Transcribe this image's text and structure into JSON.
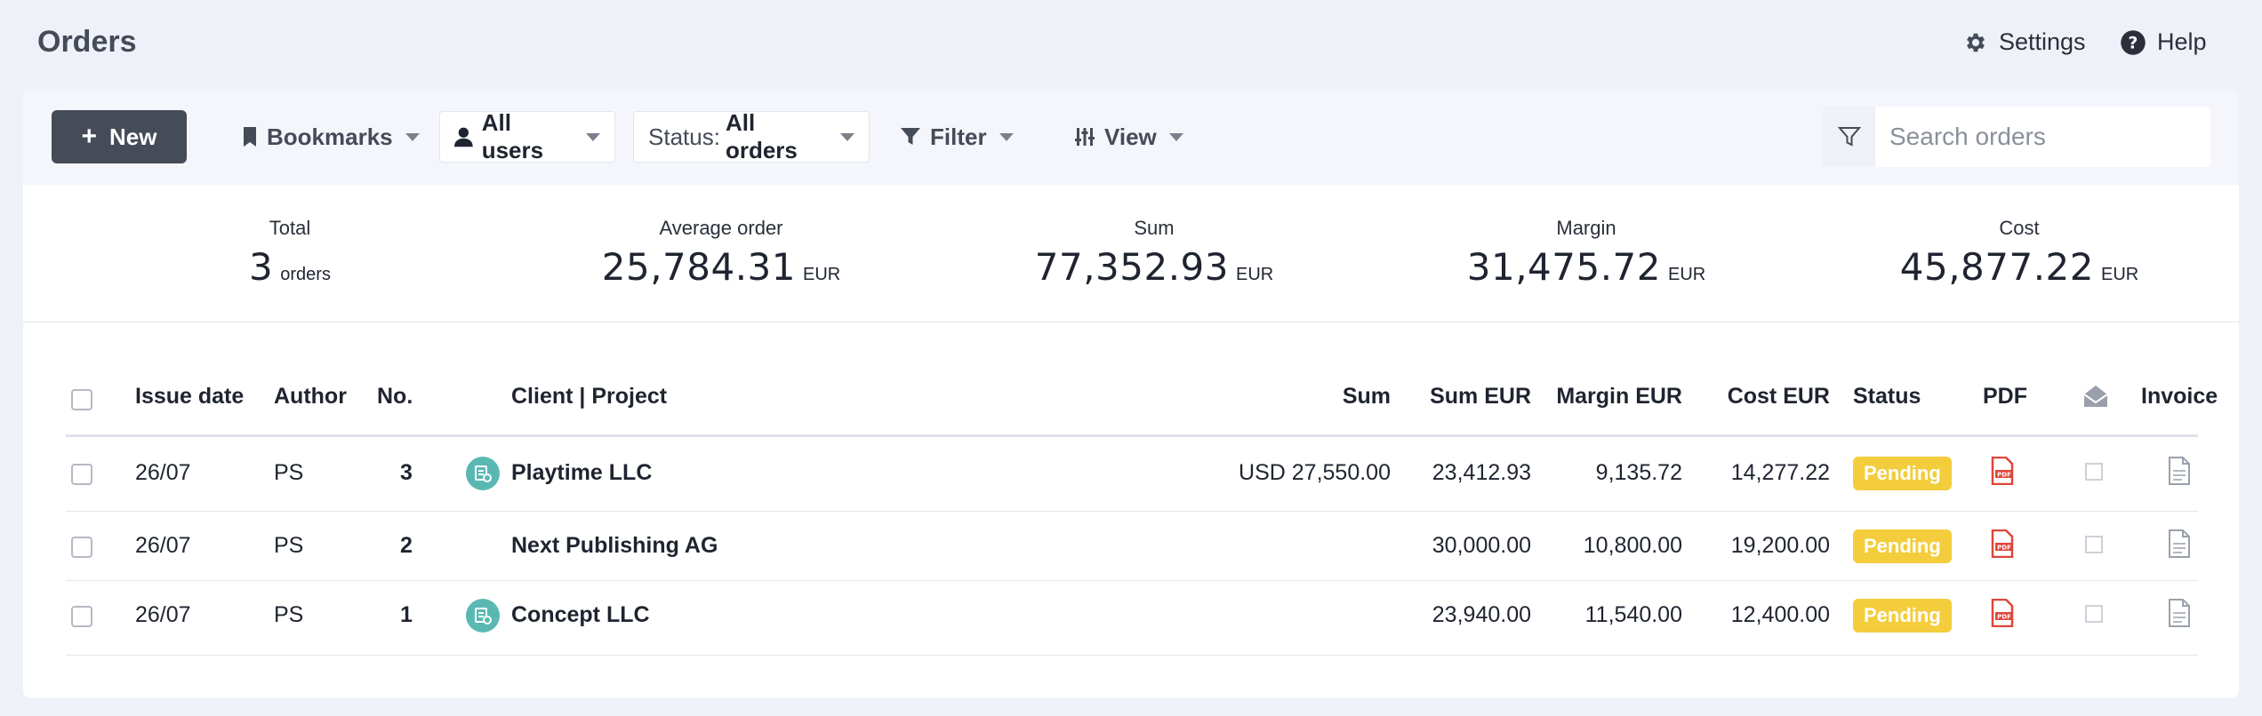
{
  "header": {
    "title": "Orders",
    "settings_label": "Settings",
    "help_label": "Help"
  },
  "toolbar": {
    "new_label": "New",
    "bookmarks_label": "Bookmarks",
    "users_label": "All users",
    "status_prefix": "Status:",
    "status_value": "All orders",
    "filter_label": "Filter",
    "view_label": "View",
    "search_placeholder": "Search orders"
  },
  "stats": [
    {
      "label": "Total",
      "value": "3",
      "unit": "orders"
    },
    {
      "label": "Average order",
      "value": "25,784.31",
      "unit": "EUR"
    },
    {
      "label": "Sum",
      "value": "77,352.93",
      "unit": "EUR"
    },
    {
      "label": "Margin",
      "value": "31,475.72",
      "unit": "EUR"
    },
    {
      "label": "Cost",
      "value": "45,877.22",
      "unit": "EUR"
    }
  ],
  "table": {
    "columns": {
      "issue_date": "Issue date",
      "author": "Author",
      "no": "No.",
      "client_project": "Client | Project",
      "sum": "Sum",
      "sum_eur": "Sum EUR",
      "margin_eur": "Margin EUR",
      "cost_eur": "Cost EUR",
      "status": "Status",
      "pdf": "PDF",
      "invoice": "Invoice"
    },
    "rows": [
      {
        "date": "26/07",
        "author": "PS",
        "no": "3",
        "client": "Playtime LLC",
        "has_project_icon": true,
        "sum": "USD 27,550.00",
        "sum_eur": "23,412.93",
        "margin_eur": "9,135.72",
        "cost_eur": "14,277.22",
        "status": "Pending"
      },
      {
        "date": "26/07",
        "author": "PS",
        "no": "2",
        "client": "Next Publishing AG",
        "has_project_icon": false,
        "sum": "",
        "sum_eur": "30,000.00",
        "margin_eur": "10,800.00",
        "cost_eur": "19,200.00",
        "status": "Pending"
      },
      {
        "date": "26/07",
        "author": "PS",
        "no": "1",
        "client": "Concept LLC",
        "has_project_icon": true,
        "sum": "",
        "sum_eur": "23,940.00",
        "margin_eur": "11,540.00",
        "cost_eur": "12,400.00",
        "status": "Pending"
      }
    ]
  },
  "colors": {
    "accent_dark": "#454b57",
    "status_pending": "#f3cd3c",
    "project_icon": "#5ab8b3",
    "pdf_red": "#e0453a"
  }
}
